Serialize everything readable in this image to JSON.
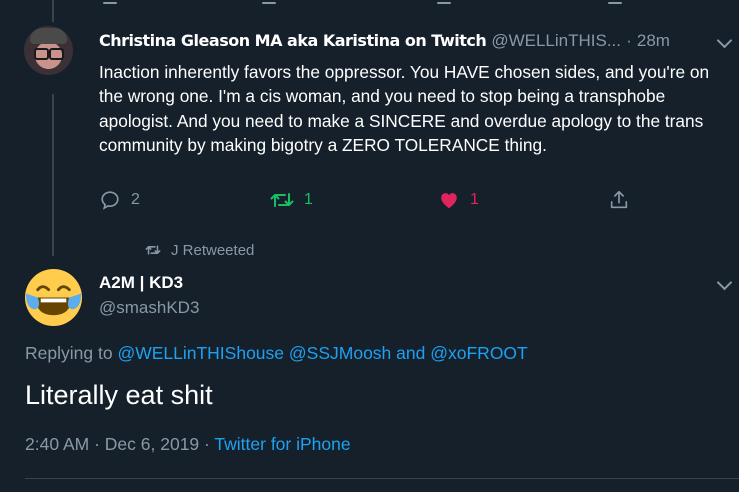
{
  "colors": {
    "background": "#15202b",
    "text_primary": "#ffffff",
    "text_secondary": "#8899a6",
    "link": "#1da1f2",
    "retweet_green": "#17bf63",
    "like_red": "#e0245e",
    "border": "#38444d"
  },
  "tweet1": {
    "display_name": "Christina Gleason MA aka Karistina on Twitch",
    "handle": "@WELLinTHIS...",
    "time_sep": "·",
    "time": "28m",
    "text": "Inaction inherently favors the oppressor. You HAVE chosen sides, and you're on the wrong one. I'm a cis woman, and you need to stop being a transphobe apologist. And you need to make a SINCERE and overdue apology to the trans community by making bigotry a ZERO TOLERANCE thing.",
    "actions": {
      "reply_icon": "reply-icon",
      "reply_count": "2",
      "retweet_icon": "retweet-icon",
      "retweet_count": "1",
      "like_icon": "heart-icon",
      "like_count": "1",
      "share_icon": "share-icon"
    }
  },
  "retweeted_by": "J Retweeted",
  "tweet2": {
    "display_name": "A2M | KD3",
    "handle": "@smashKD3",
    "replying_prefix": "Replying to",
    "mentions": [
      "@WELLinTHIShouse",
      "@SSJMoosh",
      "@xoFROOT"
    ],
    "and_word": "and",
    "text": "Literally eat shit",
    "time": "2:40 AM",
    "sep": "·",
    "date": "Dec 6, 2019",
    "source": "Twitter for iPhone"
  }
}
